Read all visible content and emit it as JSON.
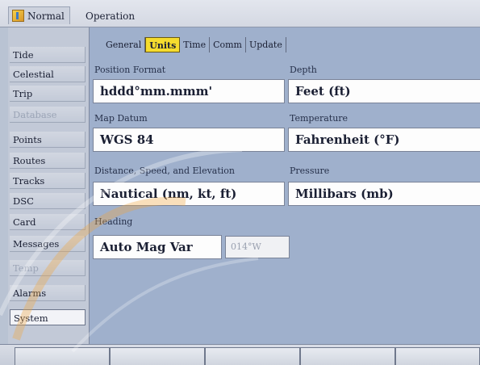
{
  "title": {
    "app_name": "Normal",
    "subtitle": "Operation"
  },
  "sidebar": {
    "items": [
      {
        "label": "Tide",
        "state": "normal"
      },
      {
        "label": "Celestial",
        "state": "normal"
      },
      {
        "label": "Trip",
        "state": "normal"
      },
      {
        "label": "Database",
        "state": "disabled"
      },
      {
        "label": "Points",
        "state": "normal"
      },
      {
        "label": "Routes",
        "state": "normal"
      },
      {
        "label": "Tracks",
        "state": "normal"
      },
      {
        "label": "DSC",
        "state": "normal"
      },
      {
        "label": "Card",
        "state": "normal"
      },
      {
        "label": "Messages",
        "state": "normal"
      },
      {
        "label": "Temp",
        "state": "disabled"
      },
      {
        "label": "Alarms",
        "state": "normal"
      },
      {
        "label": "System",
        "state": "selected"
      }
    ]
  },
  "tabs": [
    "General",
    "Units",
    "Time",
    "Comm",
    "Update"
  ],
  "active_tab": "Units",
  "settings": {
    "position_format": {
      "label": "Position Format",
      "value": "hddd°mm.mmm'"
    },
    "depth": {
      "label": "Depth",
      "value": "Feet (ft)"
    },
    "map_datum": {
      "label": "Map Datum",
      "value": "WGS 84"
    },
    "temperature": {
      "label": "Temperature",
      "value": "Fahrenheit (°F)"
    },
    "distance_speed_elevation": {
      "label": "Distance, Speed, and Elevation",
      "value": "Nautical (nm, kt, ft)"
    },
    "pressure": {
      "label": "Pressure",
      "value": "Millibars (mb)"
    },
    "heading": {
      "label": "Heading",
      "value": "Auto Mag Var",
      "variation": "014°W"
    }
  },
  "colors": {
    "active_tab": "#f5dc2e",
    "panel": "#9fb0cc",
    "sidebar": "#c2c9d7"
  }
}
